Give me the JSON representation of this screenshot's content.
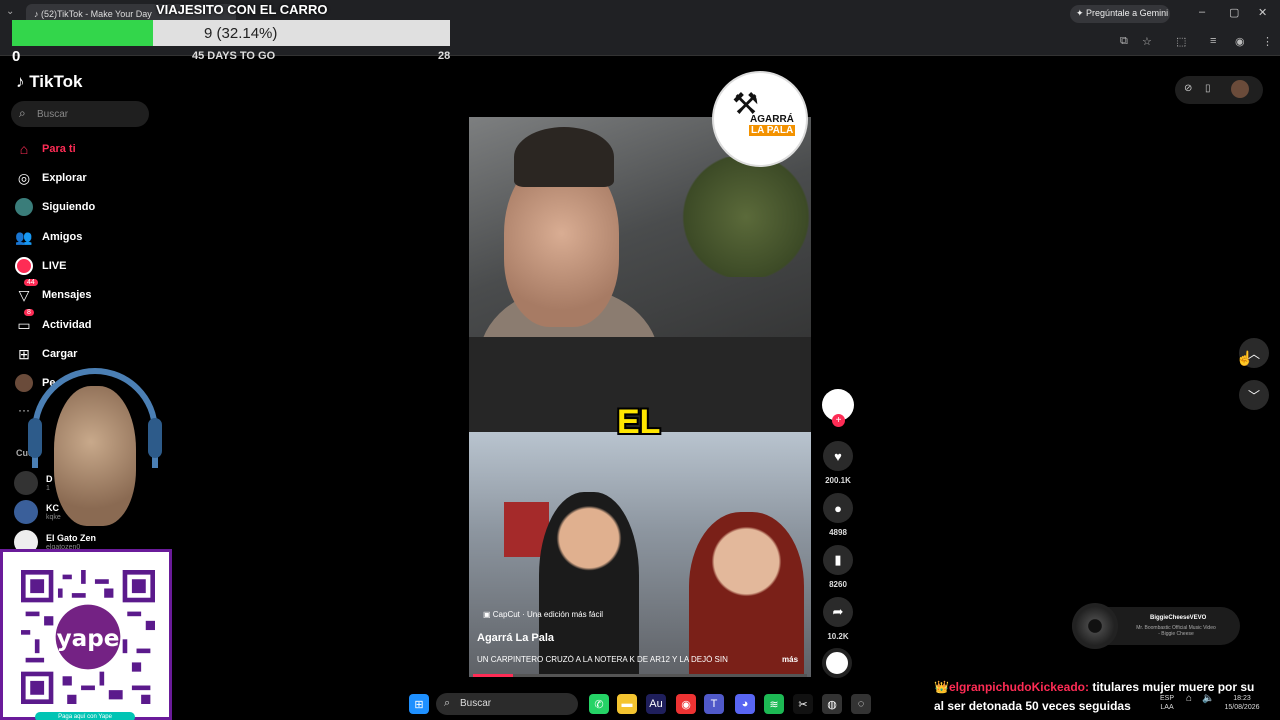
{
  "browser": {
    "tab_title": "(52)TikTok - Make Your Day",
    "gemini_label": "Pregúntale a Gemini",
    "minimize": "–",
    "maximize": "▢",
    "close": "✕"
  },
  "goal": {
    "title": "VIAJESITO CON EL CARRO",
    "label": "9 (32.14%)",
    "progress_percent": 32.14,
    "min": "0",
    "max": "28",
    "days": "45 DAYS TO GO",
    "fill_color": "#33d64b"
  },
  "tiktok": {
    "logo": "TikTok",
    "search_placeholder": "Buscar",
    "nav": [
      {
        "label": "Para ti",
        "icon": "home-icon"
      },
      {
        "label": "Explorar",
        "icon": "compass-icon"
      },
      {
        "label": "Siguiendo",
        "icon": "following-avatar-icon"
      },
      {
        "label": "Amigos",
        "icon": "friends-icon"
      },
      {
        "label": "LIVE",
        "icon": "live-icon"
      },
      {
        "label": "Mensajes",
        "icon": "messages-icon",
        "badge": "44"
      },
      {
        "label": "Actividad",
        "icon": "activity-icon",
        "badge": "8"
      },
      {
        "label": "Cargar",
        "icon": "upload-icon"
      },
      {
        "label": "Pe",
        "icon": "profile-avatar-icon"
      }
    ],
    "accounts_header": "Cue",
    "accounts": [
      {
        "name": "D",
        "handle": "1"
      },
      {
        "name": "KC",
        "handle": "kqke"
      },
      {
        "name": "El Gato Zen",
        "handle": "elgatozen0"
      }
    ],
    "qr_cta": "Paga aquí con Yape",
    "qr_brand": "yape"
  },
  "video": {
    "overlay_word": "EL",
    "capcut": "CapCut · Una edición más fácil",
    "author": "Agarrá La Pala",
    "caption": "UN CARPINTERO CRUZÓ A LA NOTERA K DE AR12 Y LA DEJÓ SIN",
    "more": "más",
    "progress_percent": 12,
    "channel_logo_line1": "AGARRÁ",
    "channel_logo_line2": "LA PALA",
    "likes": "200.1K",
    "comments": "4898",
    "saves": "8260",
    "shares": "10.2K"
  },
  "now_playing": {
    "title": "BiggieCheeseVEVO",
    "subtitle": "Mr. Boombastic Official Music Video - Biggie Cheese"
  },
  "ticker": {
    "crown": "👑",
    "user": "elgranpichudoKickeado:",
    "line1": " titulares mujer muere por su",
    "line2": "al ser detonada 50 veces seguidas"
  },
  "taskbar": {
    "search": "Buscar",
    "lang": "ESP",
    "lang2": "LAA",
    "time": "18:23",
    "date": "15/08/2026"
  }
}
